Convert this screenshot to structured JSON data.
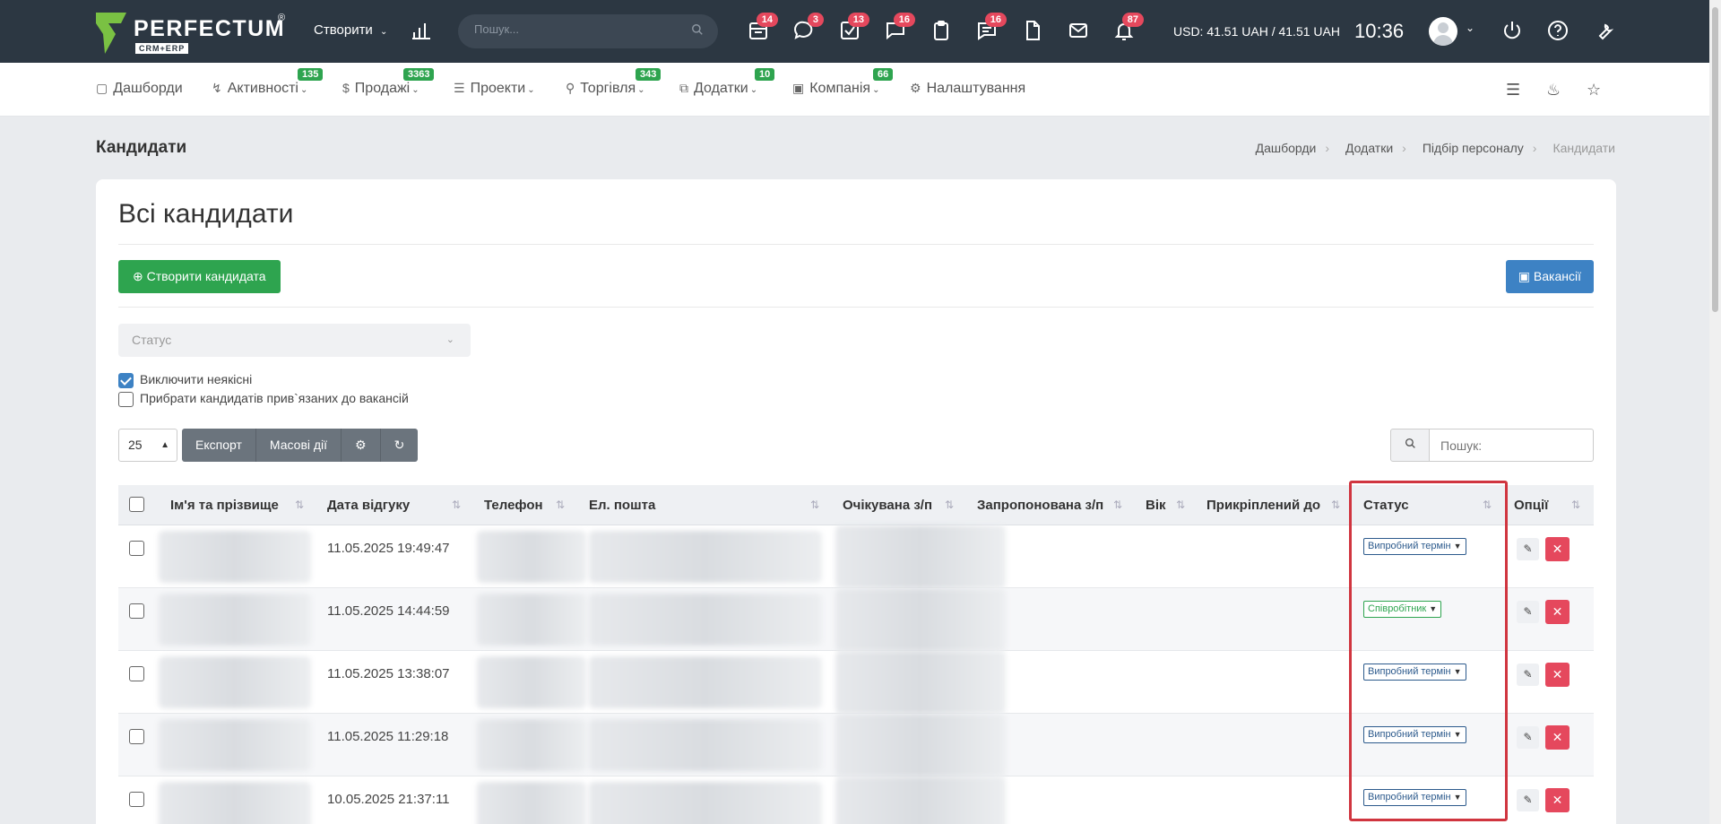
{
  "topbar": {
    "brand": "PERFECTUM",
    "brand_reg": "®",
    "brand_sub": "CRM+ERP",
    "create_label": "Створити",
    "search_placeholder": "Пошук...",
    "badges": {
      "b1": "14",
      "b2": "3",
      "b3": "13",
      "b4": "16",
      "b5": "16",
      "b6": "87"
    },
    "currency": "USD: 41.51 UAH / 41.51 UAH",
    "time": "10:36"
  },
  "nav": {
    "dashboards": "Дашборди",
    "activities": "Активності",
    "activities_badge": "135",
    "sales": "Продажі",
    "sales_badge": "3363",
    "projects": "Проекти",
    "trade": "Торгівля",
    "trade_badge": "343",
    "addons": "Додатки",
    "addons_badge": "10",
    "company": "Компанія",
    "company_badge": "66",
    "settings": "Налаштування"
  },
  "page": {
    "title": "Кандидати",
    "breadcrumb": [
      "Дашборди",
      "Додатки",
      "Підбір персоналу",
      "Кандидати"
    ],
    "card_title": "Всі кандидати",
    "create_button": "Створити кандидата",
    "vacancies_button": "Вакансії",
    "status_placeholder": "Статус",
    "exclude_label": "Виключити неякісні",
    "remove_label": "Прибрати кандидатів прив`язаних до вакансій",
    "per_page": "25",
    "export": "Експорт",
    "bulk": "Масові дії",
    "search_placeholder": "Пошук:"
  },
  "table": {
    "headers": [
      "Ім'я та прізвище",
      "Дата відгуку",
      "Телефон",
      "Ел. пошта",
      "Очікувана з/п",
      "Запропонована з/п",
      "Вік",
      "Прикріплений до",
      "Статус",
      "Опції"
    ],
    "rows": [
      {
        "date": "11.05.2025 19:49:47",
        "status": "Випробний термін"
      },
      {
        "date": "11.05.2025 14:44:59",
        "status": "Співробітник"
      },
      {
        "date": "11.05.2025 13:38:07",
        "status": "Випробний термін"
      },
      {
        "date": "11.05.2025 11:29:18",
        "status": "Випробний термін"
      },
      {
        "date": "10.05.2025 21:37:11",
        "status": "Випробний термін"
      }
    ]
  },
  "colors": {
    "topbar": "#2c3742",
    "green": "#2ea44f",
    "blue": "#3d82c4",
    "red": "#e5485d",
    "highlight": "#d0353f"
  }
}
